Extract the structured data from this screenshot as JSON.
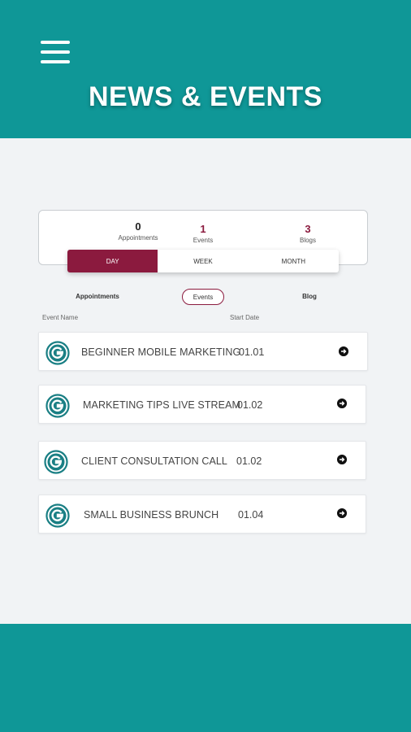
{
  "header": {
    "title": "NEWS & EVENTS",
    "menu_icon": "hamburger-menu-icon",
    "background_color": "#0f9797"
  },
  "stats": [
    {
      "count": "0",
      "label": "Appointments"
    },
    {
      "count": "1",
      "label": "Events"
    },
    {
      "count": "3",
      "label": "Blogs"
    }
  ],
  "period_tabs": [
    {
      "label": "DAY",
      "active": true
    },
    {
      "label": "WEEK",
      "active": false
    },
    {
      "label": "MONTH",
      "active": false
    }
  ],
  "section_tabs": [
    {
      "label": "Appointments",
      "active": false
    },
    {
      "label": "Events",
      "active": true
    },
    {
      "label": "Blog",
      "active": false
    }
  ],
  "columns": {
    "event_name": "Event Name",
    "start_date": "Start Date"
  },
  "events": [
    {
      "name": "BEGINNER MOBILE MARKETING",
      "date": "01.01",
      "logo_icon": "g-logo-icon",
      "action_icon": "arrow-right-circle-icon"
    },
    {
      "name": "MARKETING TIPS LIVE STREAM",
      "date": "01.02",
      "logo_icon": "g-logo-icon",
      "action_icon": "arrow-right-circle-icon"
    },
    {
      "name": "CLIENT CONSULTATION CALL",
      "date": "01.02",
      "logo_icon": "g-logo-icon",
      "action_icon": "arrow-right-circle-icon"
    },
    {
      "name": "SMALL BUSINESS BRUNCH",
      "date": "01.04",
      "logo_icon": "g-logo-icon",
      "action_icon": "arrow-right-circle-icon"
    }
  ],
  "colors": {
    "teal": "#0f9797",
    "accent": "#8b1a3e",
    "background": "#f1f3f5"
  }
}
